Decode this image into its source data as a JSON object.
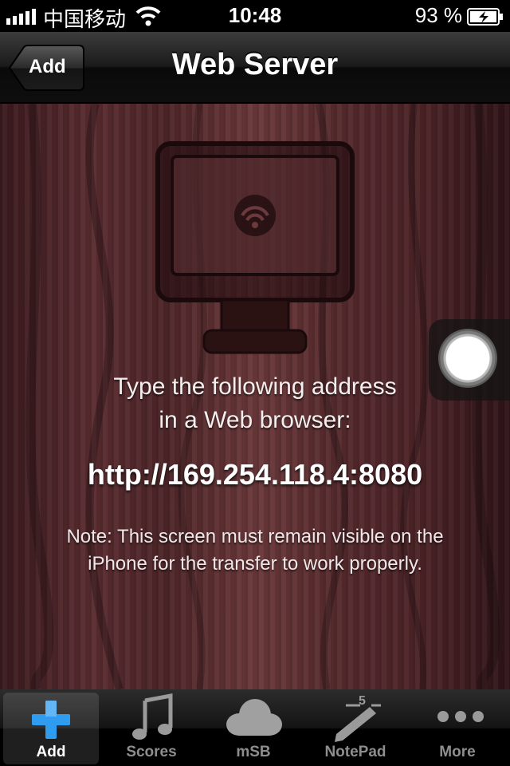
{
  "status_bar": {
    "carrier": "中国移动",
    "time": "10:48",
    "battery": "93 %",
    "icons": [
      "signal-icon",
      "wifi-icon",
      "battery-charging-icon"
    ]
  },
  "nav": {
    "back_label": "Add",
    "title": "Web Server"
  },
  "content": {
    "illustration_icon": "monitor-wifi-icon",
    "instruction_line1": "Type the following address",
    "instruction_line2": "in a Web browser:",
    "address": "http://169.254.118.4:8080",
    "note_line1": "Note: This screen must remain visible on the",
    "note_line2": "iPhone for the transfer to work properly."
  },
  "assistive_touch_icon": "assistive-touch-icon",
  "tabbar": {
    "tabs": [
      {
        "label": "Add",
        "icon": "plus-icon",
        "active": true
      },
      {
        "label": "Scores",
        "icon": "music-note-icon",
        "active": false
      },
      {
        "label": "mSB",
        "icon": "cloud-icon",
        "active": false
      },
      {
        "label": "NotePad",
        "icon": "pencil-icon",
        "active": false
      },
      {
        "label": "More",
        "icon": "more-dots-icon",
        "active": false
      }
    ],
    "notepad_badge": "5"
  }
}
